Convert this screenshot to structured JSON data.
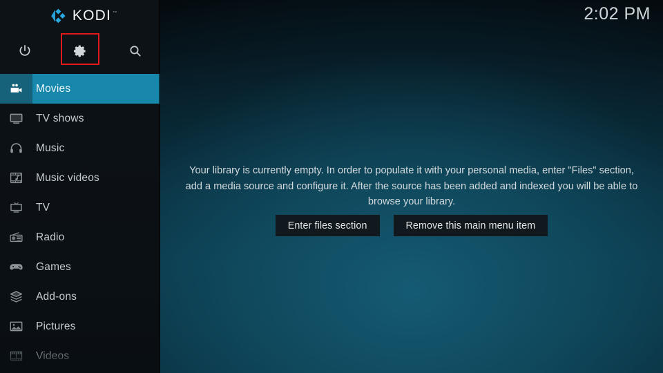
{
  "app": {
    "name": "KODI",
    "logo_trademark": "™",
    "logo_color": "#29a9e1"
  },
  "clock": {
    "time": "2:02 PM"
  },
  "toolbar": {
    "power_label": "Power",
    "settings_label": "Settings",
    "search_label": "Search",
    "icons": [
      "power-icon",
      "gear-icon",
      "search-icon"
    ],
    "highlight_color": "#e11b1b",
    "highlighted_item": "gear-icon"
  },
  "sidebar": {
    "selected_index": 0,
    "selected_bg": "#1787ab",
    "selected_icon_bg": "#16627a",
    "items": [
      {
        "label": "Movies",
        "icon": "movie-camera-icon",
        "selected": true,
        "dim": false
      },
      {
        "label": "TV shows",
        "icon": "tv-icon",
        "selected": false,
        "dim": false
      },
      {
        "label": "Music",
        "icon": "headphones-icon",
        "selected": false,
        "dim": false
      },
      {
        "label": "Music videos",
        "icon": "music-video-icon",
        "selected": false,
        "dim": false
      },
      {
        "label": "TV",
        "icon": "tv-outline-icon",
        "selected": false,
        "dim": false
      },
      {
        "label": "Radio",
        "icon": "radio-icon",
        "selected": false,
        "dim": false
      },
      {
        "label": "Games",
        "icon": "gamepad-icon",
        "selected": false,
        "dim": false
      },
      {
        "label": "Add-ons",
        "icon": "addons-box-icon",
        "selected": false,
        "dim": false
      },
      {
        "label": "Pictures",
        "icon": "picture-icon",
        "selected": false,
        "dim": false
      },
      {
        "label": "Videos",
        "icon": "film-strip-icon",
        "selected": false,
        "dim": true
      }
    ]
  },
  "main": {
    "empty_message": "Your library is currently empty. In order to populate it with your personal media, enter \"Files\" section, add a media source and configure it. After the source has been added and indexed you will be able to browse your library.",
    "buttons": [
      {
        "label": "Enter files section"
      },
      {
        "label": "Remove this main menu item"
      }
    ]
  }
}
